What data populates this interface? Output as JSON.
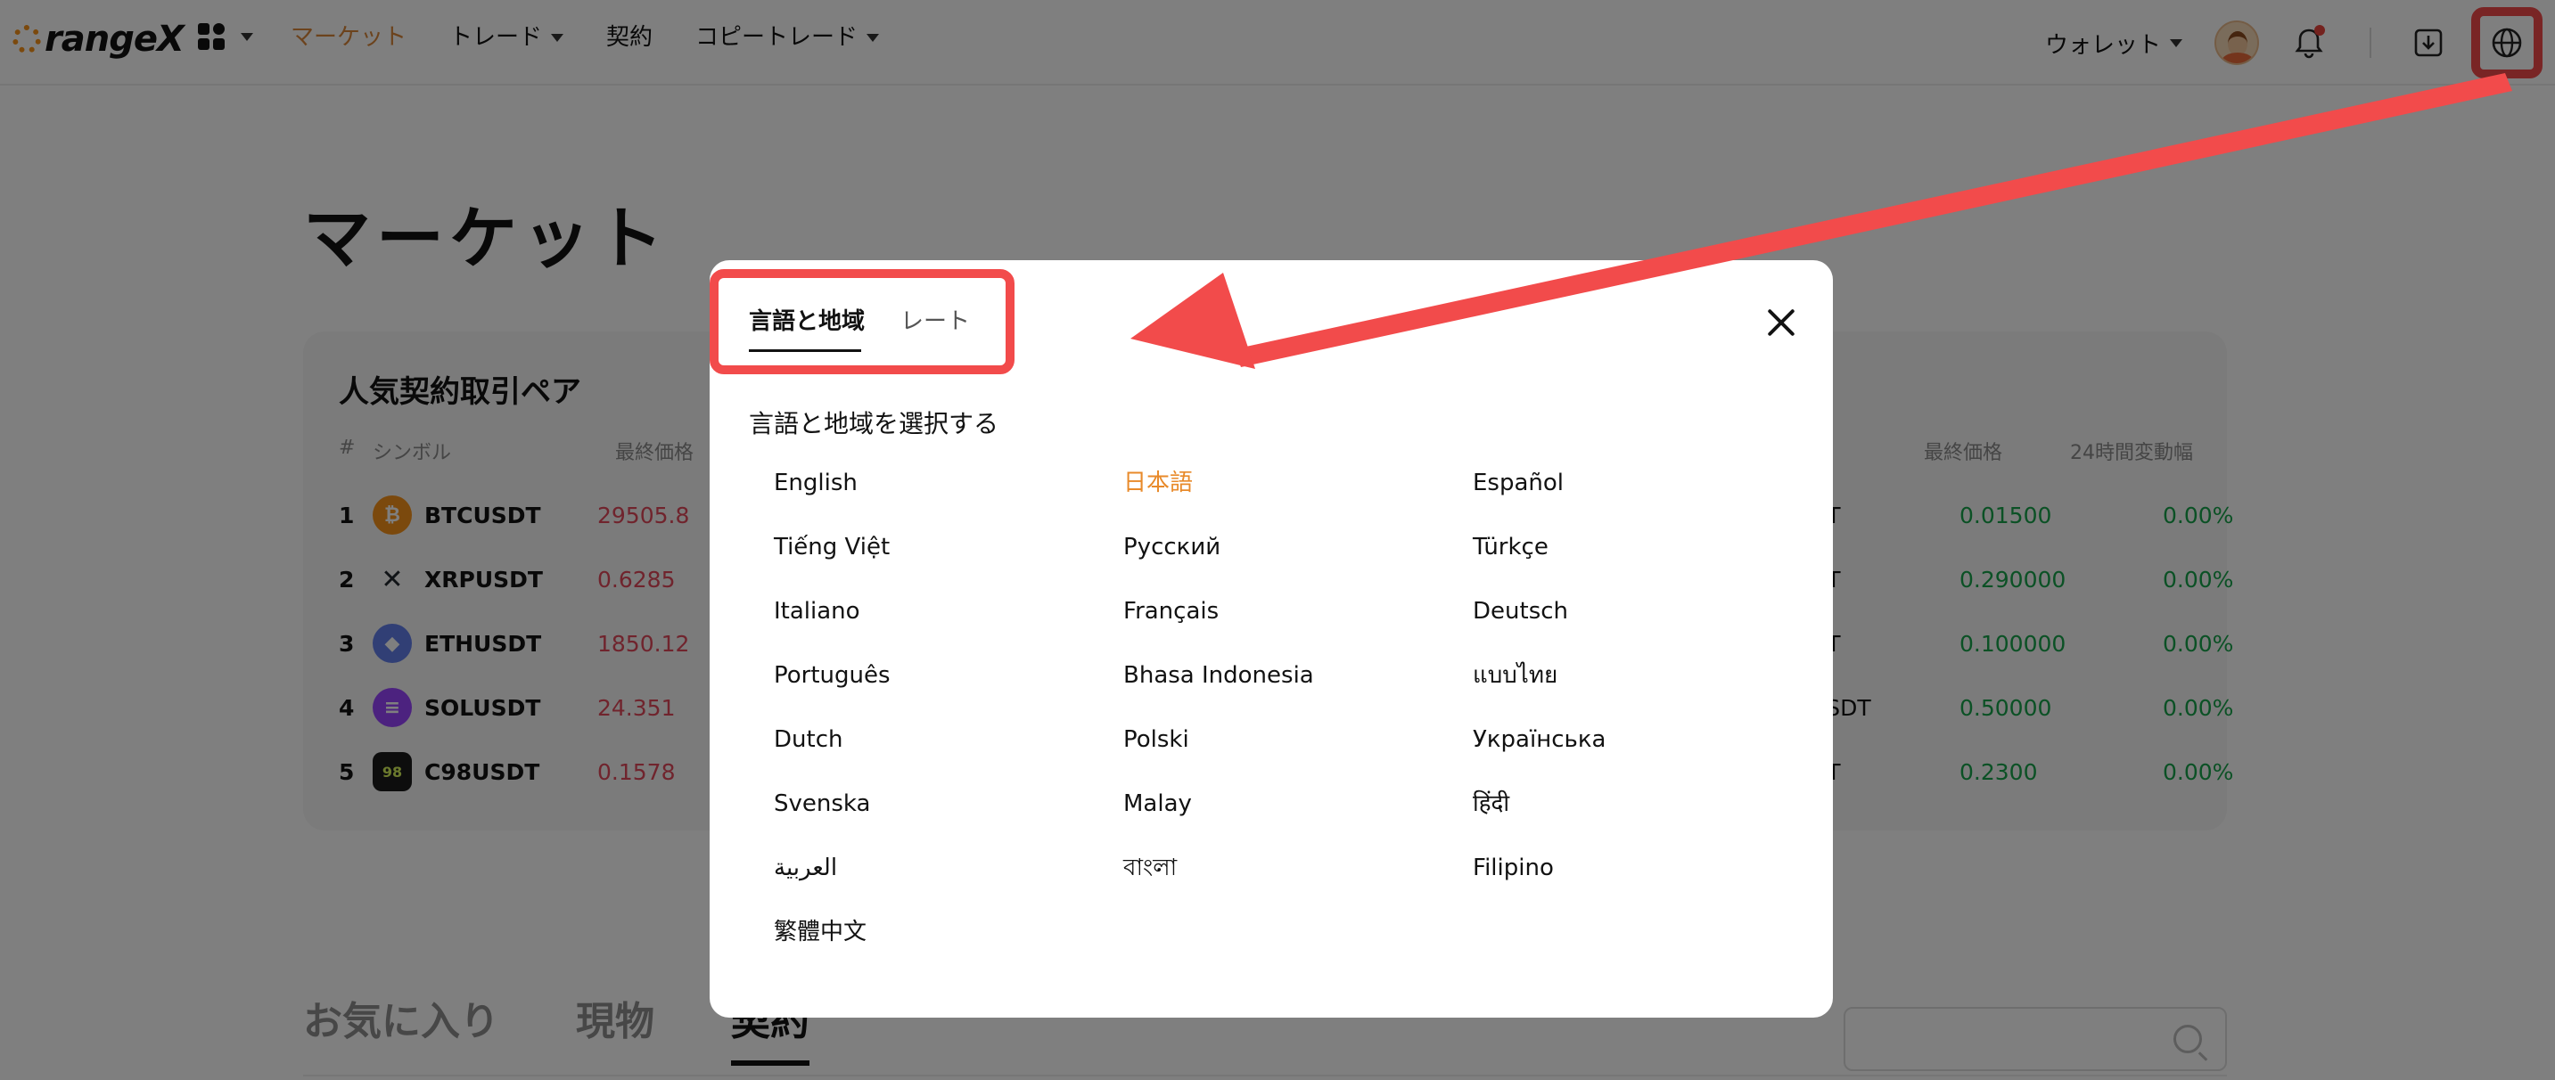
{
  "header": {
    "logo_text": "rangeX",
    "nav": [
      {
        "label": "マーケット",
        "active": true,
        "dropdown": false
      },
      {
        "label": "トレード",
        "active": false,
        "dropdown": true
      },
      {
        "label": "契約",
        "active": false,
        "dropdown": false
      },
      {
        "label": "コピートレード",
        "active": false,
        "dropdown": true
      }
    ],
    "wallet_label": "ウォレット",
    "icons": [
      "apps-grid-icon",
      "avatar",
      "bell-icon",
      "download-icon",
      "globe-icon"
    ]
  },
  "page": {
    "title": "マーケット",
    "card_title": "人気契約取引ペア",
    "headers": {
      "rank": "#",
      "symbol": "シンボル",
      "price": "最終価格",
      "right_price": "最終価格",
      "right_change": "24時間変動幅"
    },
    "rows": [
      {
        "rank": "1",
        "symbol": "BTCUSDT",
        "price": "29505.8",
        "coin_color": "#f7931a",
        "right_symbol": "DT",
        "right_price": "0.01500",
        "right_change": "0.00%"
      },
      {
        "rank": "2",
        "symbol": "XRPUSDT",
        "price": "0.6285",
        "coin_color": "#23292f",
        "right_symbol": "DT",
        "right_price": "0.290000",
        "right_change": "0.00%"
      },
      {
        "rank": "3",
        "symbol": "ETHUSDT",
        "price": "1850.12",
        "coin_color": "#627eea",
        "right_symbol": "DT",
        "right_price": "0.100000",
        "right_change": "0.00%"
      },
      {
        "rank": "4",
        "symbol": "SOLUSDT",
        "price": "24.351",
        "coin_color": "#9945ff",
        "right_symbol": "USDT",
        "right_price": "0.50000",
        "right_change": "0.00%"
      },
      {
        "rank": "5",
        "symbol": "C98USDT",
        "price": "0.1578",
        "coin_color": "#1b1b1b",
        "right_symbol": "DT",
        "right_price": "0.2300",
        "right_change": "0.00%"
      }
    ],
    "bottom_tabs": [
      {
        "label": "お気に入り",
        "active": false
      },
      {
        "label": "現物",
        "active": false
      },
      {
        "label": "契約",
        "active": true
      }
    ]
  },
  "modal": {
    "tabs": [
      {
        "label": "言語と地域",
        "active": true
      },
      {
        "label": "レート",
        "active": false
      }
    ],
    "subtitle": "言語と地域を選択する",
    "languages": [
      {
        "label": "English",
        "selected": false
      },
      {
        "label": "日本語",
        "selected": true
      },
      {
        "label": "Español",
        "selected": false
      },
      {
        "label": "Tiếng Việt",
        "selected": false
      },
      {
        "label": "Русский",
        "selected": false
      },
      {
        "label": "Türkçe",
        "selected": false
      },
      {
        "label": "Italiano",
        "selected": false
      },
      {
        "label": "Français",
        "selected": false
      },
      {
        "label": "Deutsch",
        "selected": false
      },
      {
        "label": "Português",
        "selected": false
      },
      {
        "label": "Bhasa Indonesia",
        "selected": false
      },
      {
        "label": "แบบไทย",
        "selected": false
      },
      {
        "label": "Dutch",
        "selected": false
      },
      {
        "label": "Polski",
        "selected": false
      },
      {
        "label": "Українська",
        "selected": false
      },
      {
        "label": "Svenska",
        "selected": false
      },
      {
        "label": "Malay",
        "selected": false
      },
      {
        "label": "हिंदी",
        "selected": false
      },
      {
        "label": "العربية",
        "selected": false
      },
      {
        "label": "বাংলা",
        "selected": false
      },
      {
        "label": "Filipino",
        "selected": false
      },
      {
        "label": "繁體中文",
        "selected": false
      }
    ]
  },
  "colors": {
    "accent": "#d9873a",
    "selected_language": "#e88a2a",
    "annotation": "#f24b4b",
    "up": "#16a34a",
    "down": "#e0485b"
  }
}
